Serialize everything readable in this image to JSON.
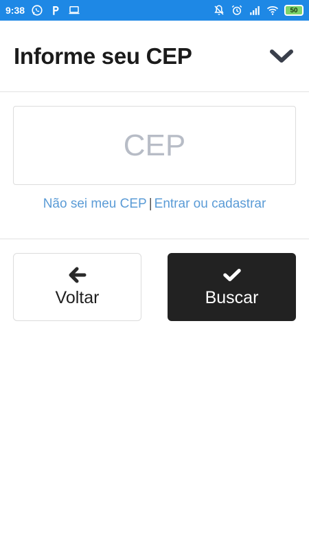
{
  "status_bar": {
    "time": "9:38",
    "battery": "50",
    "left_icons": [
      "whatsapp-icon",
      "p-app-icon",
      "laptop-icon"
    ],
    "right_icons": [
      "notifications-off-icon",
      "alarm-icon",
      "signal-icon",
      "wifi-icon"
    ]
  },
  "header": {
    "title": "Informe seu CEP",
    "collapse_icon": "chevron-down-icon",
    "icon_color": "#3a3f4b"
  },
  "cep_field": {
    "placeholder": "CEP",
    "value": ""
  },
  "links": {
    "unknown_cep": "Não sei meu CEP",
    "separator": "|",
    "login_register": "Entrar ou cadastrar",
    "link_color": "#5a9bd6"
  },
  "buttons": {
    "back": {
      "label": "Voltar",
      "icon": "arrow-left-icon"
    },
    "search": {
      "label": "Buscar",
      "icon": "check-icon",
      "background": "#222222"
    }
  },
  "colors": {
    "status_bar": "#1e88e5",
    "placeholder": "#b7bcc6",
    "border": "#dcdcdc"
  }
}
